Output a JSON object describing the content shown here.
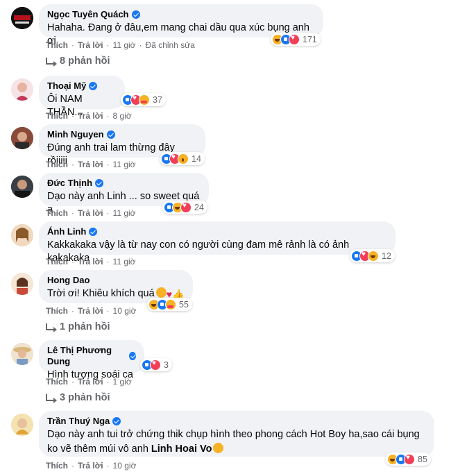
{
  "actions": {
    "like": "Thích",
    "reply": "Trả lời"
  },
  "comments": [
    {
      "name": "Ngọc Tuyên Quách",
      "text": "Hahaha. Đang ở đâu,em mang chai dầu qua xúc bụng anh ơi",
      "reaction_count": "171",
      "reaction_icons": [
        "haha-icon",
        "like-icon",
        "love-icon"
      ],
      "time": "11 giờ",
      "edited": "Đã chỉnh sửa",
      "replies": "8 phản hồi"
    },
    {
      "name": "Thoại Mỹ",
      "text": "Ôi NAM THẦN...",
      "reaction_count": "37",
      "reaction_icons": [
        "like-icon",
        "love-icon",
        "care-icon"
      ],
      "time": "8 giờ"
    },
    {
      "name": "Minh Nguyen",
      "text": "Đúng anh trai lam thừng đây rồiiiii",
      "reaction_count": "14",
      "reaction_icons": [
        "like-icon",
        "love-icon",
        "wow-icon"
      ],
      "time": "11 giờ"
    },
    {
      "name": "Đức Thịnh",
      "text": "Dạo này anh Linh ... so sweet quá ạ",
      "reaction_count": "24",
      "reaction_icons": [
        "like-icon",
        "haha-icon",
        "love-icon"
      ],
      "time": "11 giờ"
    },
    {
      "name": "Ánh Linh",
      "text": "Kakkakaka vậy là từ nay con có người cùng đam mê rảnh là có ảnh kakakaka",
      "reaction_count": "12",
      "reaction_icons": [
        "like-icon",
        "love-icon",
        "haha-icon"
      ],
      "time": "11 giờ"
    },
    {
      "name": "Hong Dao",
      "text": "Trời ơi! Khiêu khích quá",
      "text_emojis": [
        "heart-eyes-icon",
        "heart-icon",
        "thumbs-up-icon"
      ],
      "reaction_count": "55",
      "reaction_icons": [
        "haha-icon",
        "like-icon",
        "care-icon"
      ],
      "time": "10 giờ",
      "replies": "1 phản hồi"
    },
    {
      "name": "Lê Thị Phương Dung",
      "text": "Hình tượng soái ca",
      "reaction_count": "3",
      "reaction_icons": [
        "like-icon",
        "love-icon"
      ],
      "time": "1 giờ",
      "replies": "3 phản hồi"
    },
    {
      "name": "Trần Thuý Nga",
      "text": "Dạo này anh tui trở chứng thik chụp hình theo phong cách Hot Boy ha,sao cái bụng",
      "text2": "ko vẽ thêm múi vô anh",
      "mention": "Linh Hoai Vo",
      "text_emojis": [
        "tongue-wink-icon"
      ],
      "reaction_count": "85",
      "reaction_icons": [
        "haha-icon",
        "like-icon",
        "love-icon"
      ],
      "time": "10 giờ"
    }
  ],
  "colors": {
    "bubble": "#f0f2f5",
    "meta": "#65676b",
    "like": "#1877f2",
    "love": "#f33e58",
    "haha": "#f7b125"
  }
}
